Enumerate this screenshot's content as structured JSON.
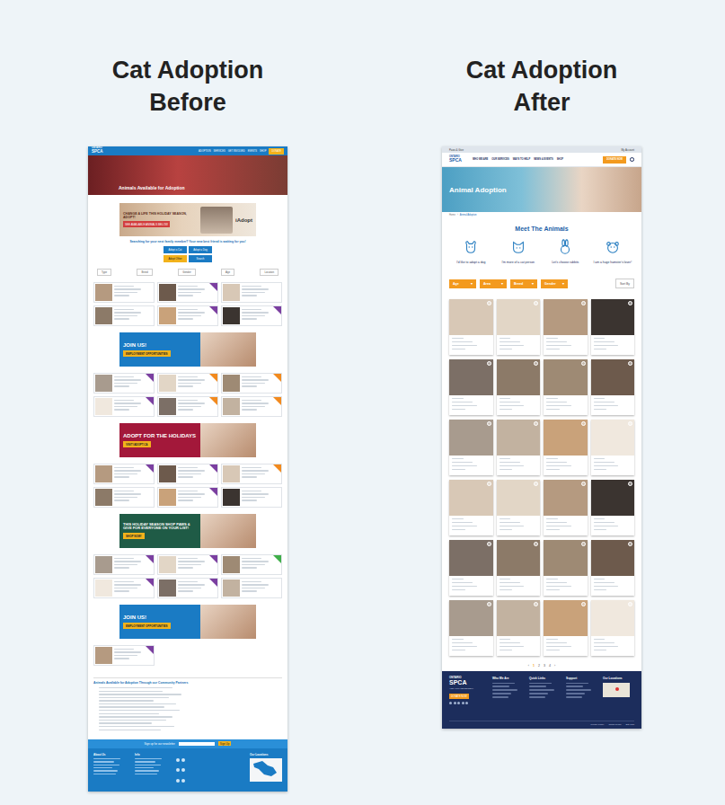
{
  "titles": [
    {
      "line1": "Cat Adoption",
      "line2": "Before"
    },
    {
      "line1": "Cat Adoption",
      "line2": "After"
    }
  ],
  "before": {
    "nav": {
      "logo": {
        "top": "ONTARIO",
        "main": "SPCA"
      },
      "links": [
        "ADOPTION",
        "SERVICES",
        "GET INVOLVED",
        "EVENTS",
        "SHOP"
      ],
      "donate": "DONATE"
    },
    "hero": "Animals Available for Adoption",
    "promo": {
      "headline": "CHANGE A LIFE THIS HOLIDAY SEASON, ADOPT!",
      "button": "SEE AVAILABLE ANIMALS BELOW",
      "brand": "iAdopt"
    },
    "intro": "Searching for your next family member? Your new best friend is waiting for you!",
    "buttons": [
      {
        "label": "Adopt a Cat",
        "color": "#1a7bc4"
      },
      {
        "label": "Adopt a Dog",
        "color": "#1a7bc4"
      },
      {
        "label": "Adopt Other",
        "color": "#f2b21b"
      },
      {
        "label": "Search",
        "color": "#1a7bc4"
      }
    ],
    "filters": [
      "Type",
      "Breed",
      "Gender",
      "Age",
      "Location"
    ],
    "sections": [
      {
        "kind": "cards",
        "cards": [
          {
            "tagged": false
          },
          {
            "tagged": true,
            "color": "#7b3fa0"
          },
          {
            "tagged": false
          },
          {
            "tagged": false
          },
          {
            "tagged": true,
            "color": "#7b3fa0"
          },
          {
            "tagged": true,
            "color": "#7b3fa0"
          }
        ]
      },
      {
        "kind": "banner",
        "title": "JOIN US!",
        "button": "EMPLOYMENT OPPORTUNITIES",
        "color": "#1a7bc4"
      },
      {
        "kind": "cards",
        "cards": [
          {
            "tagged": true,
            "color": "#7b3fa0"
          },
          {
            "tagged": true,
            "color": "#f28a1e"
          },
          {
            "tagged": true,
            "color": "#f28a1e"
          },
          {
            "tagged": true,
            "color": "#7b3fa0"
          },
          {
            "tagged": true,
            "color": "#f28a1e"
          },
          {
            "tagged": true,
            "color": "#f28a1e"
          }
        ]
      },
      {
        "kind": "banner",
        "title": "ADOPT FOR THE HOLIDAYS",
        "button": "VISIT IADOPT.CA",
        "color": "#a3183a"
      },
      {
        "kind": "cards",
        "cards": [
          {
            "tagged": true,
            "color": "#7b3fa0"
          },
          {
            "tagged": true,
            "color": "#7b3fa0"
          },
          {
            "tagged": true,
            "color": "#f28a1e"
          },
          {
            "tagged": false
          },
          {
            "tagged": true,
            "color": "#7b3fa0"
          },
          {
            "tagged": false
          }
        ]
      },
      {
        "kind": "banner",
        "title": "THIS HOLIDAY SEASON SHOP PAWS & GIVE FOR EVERYONE ON YOUR LIST!",
        "button": "SHOP NOW!",
        "color": "#1f5b46"
      },
      {
        "kind": "cards",
        "cards": [
          {
            "tagged": true,
            "color": "#7b3fa0"
          },
          {
            "tagged": true,
            "color": "#7b3fa0"
          },
          {
            "tagged": true,
            "color": "#3fae49"
          },
          {
            "tagged": true,
            "color": "#7b3fa0"
          },
          {
            "tagged": true,
            "color": "#7b3fa0"
          },
          {
            "tagged": false
          }
        ]
      },
      {
        "kind": "banner",
        "title": "JOIN US!",
        "button": "EMPLOYMENT OPPORTUNITIES",
        "color": "#1a7bc4"
      },
      {
        "kind": "cards",
        "cards": [
          {
            "tagged": true,
            "color": "#7b3fa0"
          }
        ]
      }
    ],
    "partners": "Animals Available for Adoption Through our Community Partners",
    "newsletter": {
      "label": "Sign up for our newsletter",
      "button": "Sign Up"
    },
    "footer": {
      "columns": [
        "About Us",
        "Info"
      ],
      "map": "Our Locations"
    }
  },
  "after": {
    "topbar": {
      "text": "Paws & Give",
      "account": "My Account"
    },
    "nav": {
      "logo": {
        "top": "ONTARIO",
        "main": "SPCA"
      },
      "links": [
        "WHO WE ARE",
        "OUR SERVICES",
        "WAYS TO HELP",
        "NEWS & EVENTS",
        "SHOP"
      ],
      "donate": "DONATE NOW"
    },
    "hero": "Animal Adoption",
    "breadcrumb": [
      "Home",
      "›",
      "Animal Adoption"
    ],
    "heading": "Meet The Animals",
    "categories": [
      {
        "kind": "dog",
        "label": "I'd like to adopt a dog"
      },
      {
        "kind": "cat",
        "label": "I'm more of a cat person"
      },
      {
        "kind": "rabbit",
        "label": "Let's choose rabbits"
      },
      {
        "kind": "hamster",
        "label": "I am a huge hamster's lover!"
      }
    ],
    "filters": [
      "Age",
      "Area",
      "Breed",
      "Gender"
    ],
    "caret": "▾",
    "sort": "Sort By",
    "cards": [
      {
        "favorite": false
      },
      {
        "favorite": false
      },
      {
        "favorite": false
      },
      {
        "favorite": false
      },
      {
        "favorite": false
      },
      {
        "favorite": false
      },
      {
        "favorite": false
      },
      {
        "favorite": false
      },
      {
        "favorite": false
      },
      {
        "favorite": false
      },
      {
        "favorite": false
      },
      {
        "favorite": false
      },
      {
        "favorite": false
      },
      {
        "favorite": false
      },
      {
        "favorite": false
      },
      {
        "favorite": false
      },
      {
        "favorite": false
      },
      {
        "favorite": false
      },
      {
        "favorite": false
      },
      {
        "favorite": false
      },
      {
        "favorite": false
      },
      {
        "favorite": false
      },
      {
        "favorite": false
      },
      {
        "favorite": false
      }
    ],
    "pagination": [
      {
        "label": "‹",
        "selected": false
      },
      {
        "label": "1",
        "selected": true
      },
      {
        "label": "2",
        "selected": false
      },
      {
        "label": "3",
        "selected": false
      },
      {
        "label": "4",
        "selected": false
      },
      {
        "label": "›",
        "selected": false
      }
    ],
    "footer": {
      "logo": {
        "top": "ONTARIO",
        "main": "SPCA"
      },
      "tagline": "AND HUMANE SOCIETY",
      "button": "DONATE NOW",
      "columns": [
        "Who We Are",
        "Quick Links",
        "Support",
        "Our Locations"
      ],
      "bottom": [
        "Privacy Policy",
        "Terms of Use",
        "Site Map"
      ]
    }
  }
}
